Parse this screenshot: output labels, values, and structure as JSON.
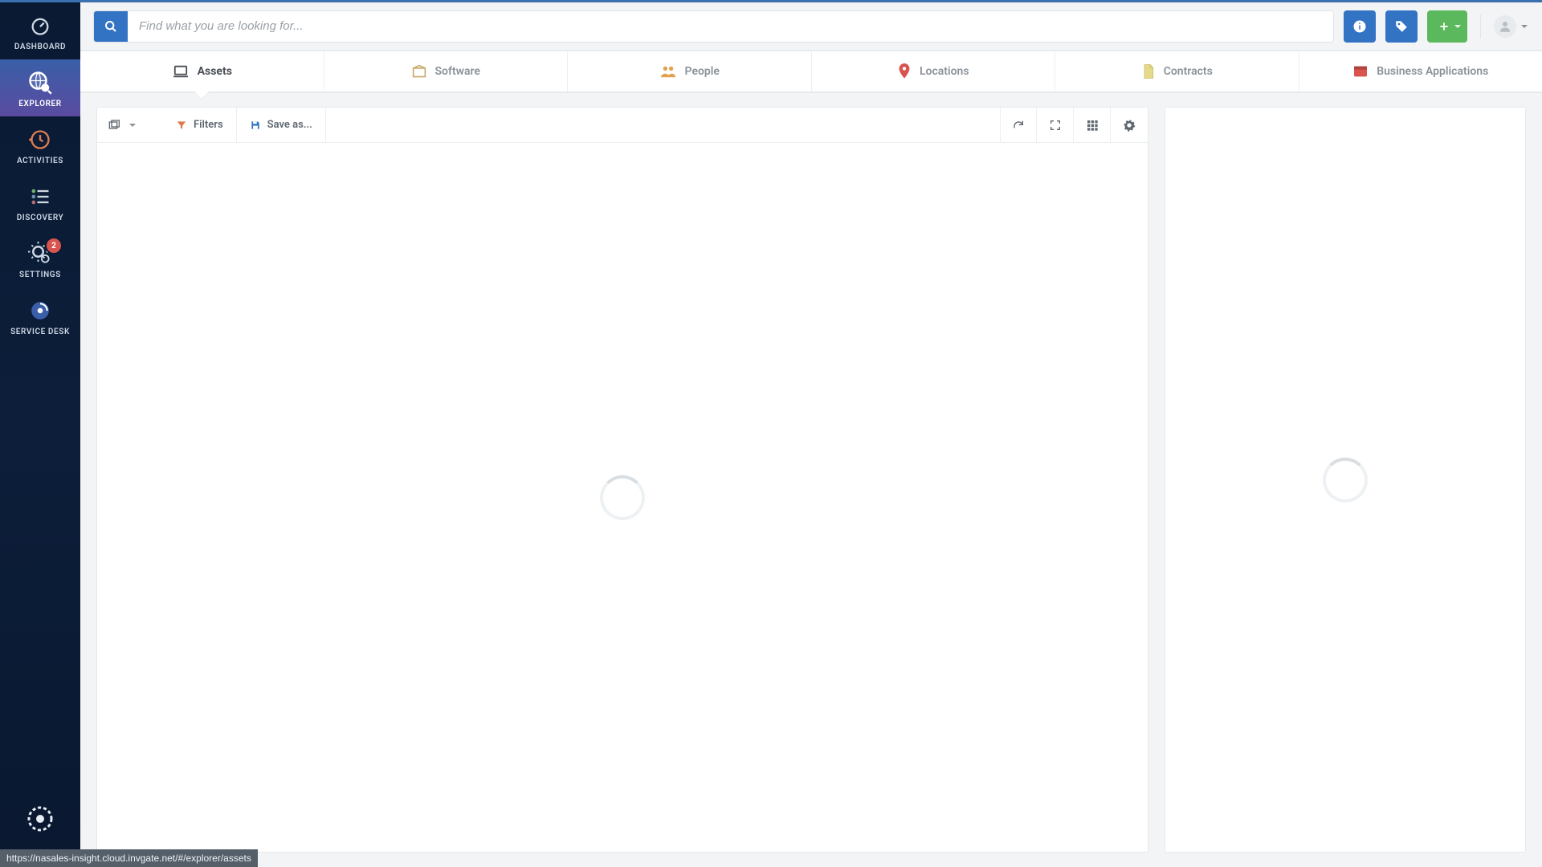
{
  "sidebar": {
    "items": [
      {
        "label": "DASHBOARD"
      },
      {
        "label": "EXPLORER"
      },
      {
        "label": "ACTIVITIES"
      },
      {
        "label": "DISCOVERY"
      },
      {
        "label": "SETTINGS",
        "badge": "2"
      },
      {
        "label": "SERVICE DESK"
      }
    ]
  },
  "topbar": {
    "search_placeholder": "Find what you are looking for..."
  },
  "tabs": [
    {
      "label": "Assets"
    },
    {
      "label": "Software"
    },
    {
      "label": "People"
    },
    {
      "label": "Locations"
    },
    {
      "label": "Contracts"
    },
    {
      "label": "Business Applications"
    }
  ],
  "toolbar": {
    "filters_label": "Filters",
    "save_as_label": "Save as..."
  },
  "status_url": "https://nasales-insight.cloud.invgate.net/#/explorer/assets"
}
